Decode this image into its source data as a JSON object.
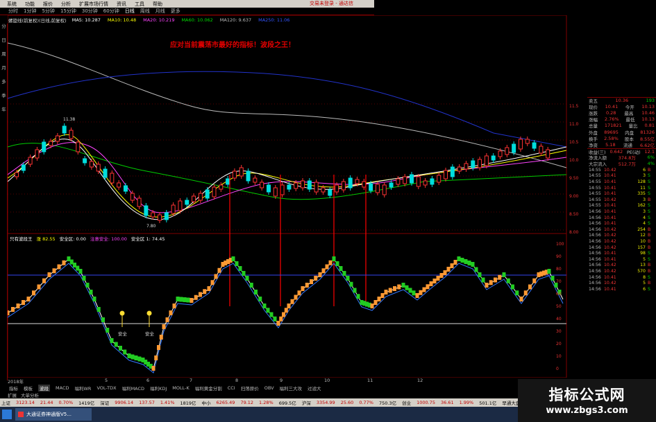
{
  "menu": {
    "items": [
      "系统",
      "功能",
      "报价",
      "分析",
      "扩展市场行情",
      "资讯",
      "工具",
      "帮助"
    ],
    "brand": "交易未登录 - 通达信"
  },
  "periods": [
    {
      "label": "分时",
      "active": false
    },
    {
      "label": "1分钟",
      "active": false
    },
    {
      "label": "5分钟",
      "active": false
    },
    {
      "label": "15分钟",
      "active": false
    },
    {
      "label": "30分钟",
      "active": false
    },
    {
      "label": "60分钟",
      "active": false
    },
    {
      "label": "日线",
      "active": true
    },
    {
      "label": "周线",
      "active": false
    },
    {
      "label": "月线",
      "active": false
    },
    {
      "label": "更多",
      "active": false
    }
  ],
  "ma_legend": {
    "title": "螺旋线(前复权)(日线,前复权)",
    "items": [
      {
        "label": "MA5: 10.287",
        "color": "#ffffff"
      },
      {
        "label": "MA10: 10.48",
        "color": "#ffff00"
      },
      {
        "label": "MA20: 10.219",
        "color": "#ff44ff"
      },
      {
        "label": "MA60: 10.062",
        "color": "#00dd00"
      },
      {
        "label": "MA120: 9.637",
        "color": "#bbbbbb"
      },
      {
        "label": "MA250: 11.06",
        "color": "#3355ff"
      }
    ]
  },
  "left_tabs": [
    "分",
    "日",
    "周",
    "月",
    "多",
    "季",
    "年"
  ],
  "headline": "应对当前震荡市最好的指标！波段之王！",
  "chart": {
    "high_label": "11.38",
    "low_label": "7.80"
  },
  "indicator": {
    "name": "只有波段王",
    "values": [
      {
        "label": "涨 82.55",
        "color": "#ffff00"
      },
      {
        "label": "安全区: 0.00",
        "color": "#ffffff"
      },
      {
        "label": "注意安全: 100.00",
        "color": "#ff44ff"
      },
      {
        "label": "安全区 1: 74.45",
        "color": "#ffffff"
      }
    ],
    "signal_labels": [
      "安全",
      "安全"
    ]
  },
  "time_axis": [
    "2018年",
    "5",
    "6",
    "7",
    "8",
    "9",
    "10",
    "11",
    "12"
  ],
  "indicator_tabs": [
    {
      "label": "指标",
      "active": false
    },
    {
      "label": "模板",
      "active": false
    },
    {
      "label": "波段",
      "active": true
    },
    {
      "label": "MACD",
      "active": false
    },
    {
      "label": "福利WR",
      "active": false
    },
    {
      "label": "VOL-TDX",
      "active": false
    },
    {
      "label": "福利MACD",
      "active": false
    },
    {
      "label": "福利KDJ",
      "active": false
    },
    {
      "label": "MOLL-K",
      "active": false
    },
    {
      "label": "福利黄金分割",
      "active": false
    },
    {
      "label": "CCI",
      "active": false
    },
    {
      "label": "扫荡原价",
      "active": false
    },
    {
      "label": "OBV",
      "active": false
    },
    {
      "label": "福利三大攻",
      "active": false
    },
    {
      "label": "过滤大",
      "active": false
    }
  ],
  "sub_tabs": [
    "扩展",
    "大单分析"
  ],
  "status_bar": [
    {
      "label": "上证",
      "value": "3123.14",
      "change": "21.44",
      "pct": "0.70%",
      "amount": "1419亿",
      "dir": "up"
    },
    {
      "label": "深证",
      "value": "9906.14",
      "change": "137.57",
      "pct": "1.41%",
      "amount": "1819亿",
      "dir": "up"
    },
    {
      "label": "中小",
      "value": "6265.49",
      "change": "79.12",
      "pct": "1.28%",
      "amount": "699.5亿",
      "dir": "up"
    },
    {
      "label": "沪深",
      "value": "3354.99",
      "change": "25.60",
      "pct": "0.77%",
      "amount": "750.3亿",
      "dir": "up"
    },
    {
      "label": "创业",
      "value": "1000.75",
      "change": "36.61",
      "pct": "1.99%",
      "amount": "501.1亿",
      "dir": "up"
    }
  ],
  "status_tail": "早通大盘",
  "taskbar": {
    "task_label": "大通证券神通版V5..."
  },
  "watermark": {
    "line1": "指标公式网",
    "line2": "www.zbgs3.com"
  },
  "quote": {
    "rows": [
      {
        "l": "卖五",
        "v": "10.36",
        "v2": "193"
      },
      {
        "l": "现价",
        "v": "10.41",
        "l2": "今开",
        "v3": "10.13"
      },
      {
        "l": "涨跌",
        "v": "0.28",
        "l2": "最高",
        "v3": "10.46"
      },
      {
        "l": "涨幅",
        "v": "2.76%",
        "l2": "最低",
        "v3": "10.13"
      },
      {
        "l": "总量",
        "v": "171821",
        "l2": "量比",
        "v3": "0.81"
      },
      {
        "l": "外盘",
        "v": "89695",
        "l2": "内盘",
        "v3": "81326"
      },
      {
        "l": "换手",
        "v": "2.58%",
        "l2": "股本",
        "v3": "8.55亿"
      },
      {
        "l": "净资",
        "v": "5.18",
        "l2": "流通",
        "v3": "6.62亿"
      },
      {
        "l": "收益(三)",
        "v": "0.642",
        "l2": "PE(动)",
        "v3": "12.1"
      },
      {
        "l": "净流入额",
        "v": "374.8万",
        "v2": "6%"
      },
      {
        "l": "大宗流入",
        "v": "512.7万",
        "v2": "4%"
      }
    ],
    "trades": [
      {
        "t": "14:55",
        "p": "10.42",
        "v": "6",
        "s": "B"
      },
      {
        "t": "14:55",
        "p": "10.41",
        "v": "3",
        "s": "S"
      },
      {
        "t": "14:55",
        "p": "10.41",
        "v": "128",
        "s": "S"
      },
      {
        "t": "14:55",
        "p": "10.41",
        "v": "11",
        "s": "S"
      },
      {
        "t": "14:55",
        "p": "10.41",
        "v": "335",
        "s": "S"
      },
      {
        "t": "14:55",
        "p": "10.42",
        "v": "3",
        "s": "B"
      },
      {
        "t": "14:55",
        "p": "10.41",
        "v": "162",
        "s": "S"
      },
      {
        "t": "14:56",
        "p": "10.41",
        "v": "3",
        "s": "S"
      },
      {
        "t": "14:56",
        "p": "10.41",
        "v": "4",
        "s": "S"
      },
      {
        "t": "14:56",
        "p": "10.41",
        "v": "4",
        "s": "S"
      },
      {
        "t": "14:56",
        "p": "10.42",
        "v": "254",
        "s": "B"
      },
      {
        "t": "14:56",
        "p": "10.42",
        "v": "12",
        "s": "B"
      },
      {
        "t": "14:56",
        "p": "10.42",
        "v": "10",
        "s": "B"
      },
      {
        "t": "14:56",
        "p": "10.42",
        "v": "157",
        "s": "B"
      },
      {
        "t": "14:56",
        "p": "10.41",
        "v": "98",
        "s": "S"
      },
      {
        "t": "14:56",
        "p": "10.41",
        "v": "5",
        "s": "S"
      },
      {
        "t": "14:56",
        "p": "10.42",
        "v": "13",
        "s": "B"
      },
      {
        "t": "14:56",
        "p": "10.42",
        "v": "570",
        "s": "B"
      },
      {
        "t": "14:56",
        "p": "10.41",
        "v": "8",
        "s": "S"
      },
      {
        "t": "14:56",
        "p": "10.42",
        "v": "5",
        "s": "B"
      },
      {
        "t": "14:56",
        "p": "10.41",
        "v": "6",
        "s": "S"
      }
    ]
  },
  "price_axis": [
    "11.5",
    "11.0",
    "10.5",
    "10.0",
    "9.50",
    "9.00",
    "8.50",
    "8.00"
  ],
  "ind_axis": [
    "100",
    "90",
    "80",
    "70",
    "60",
    "50",
    "40",
    "30",
    "20",
    "10",
    "0"
  ]
}
